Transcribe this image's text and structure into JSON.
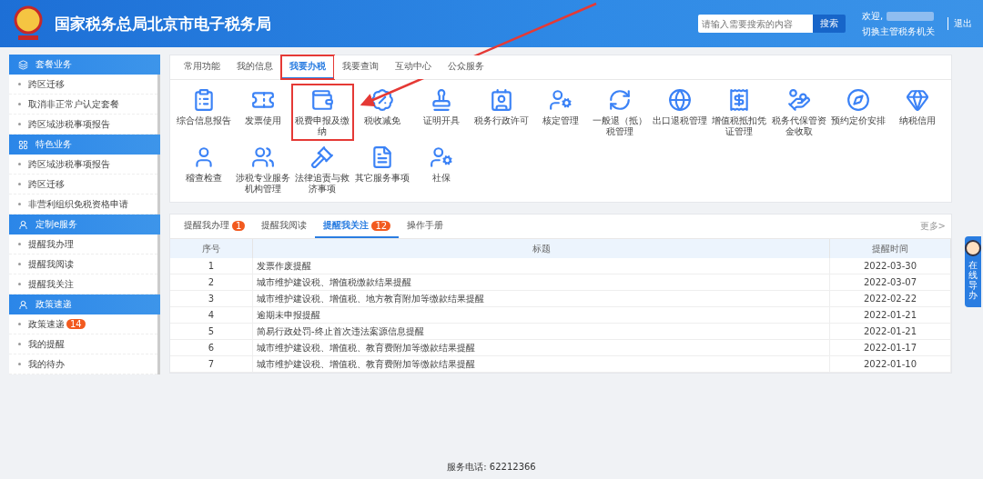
{
  "header": {
    "title": "国家税务总局北京市电子税务局",
    "search": {
      "placeholder": "请输入需要搜索的内容",
      "button": "搜索"
    },
    "welcome": "欢迎,",
    "switch_link": "切换主管税务机关",
    "logout": "退出"
  },
  "sidebar": [
    {
      "title": "套餐业务",
      "items": [
        {
          "label": "跨区迁移"
        },
        {
          "label": "取消非正常户认定套餐"
        },
        {
          "label": "跨区域涉税事项报告"
        }
      ]
    },
    {
      "title": "特色业务",
      "items": [
        {
          "label": "跨区域涉税事项报告"
        },
        {
          "label": "跨区迁移"
        },
        {
          "label": "非营利组织免税资格申请"
        }
      ]
    },
    {
      "title": "定制e服务",
      "items": [
        {
          "label": "提醒我办理"
        },
        {
          "label": "提醒我阅读"
        },
        {
          "label": "提醒我关注"
        }
      ]
    },
    {
      "title": "政策速递",
      "items": [
        {
          "label": "政策速递",
          "badge": "14"
        },
        {
          "label": "我的提醒"
        },
        {
          "label": "我的待办"
        }
      ]
    }
  ],
  "function_tabs": [
    {
      "label": "常用功能",
      "selected": false,
      "highlighted": false
    },
    {
      "label": "我的信息",
      "selected": false,
      "highlighted": false
    },
    {
      "label": "我要办税",
      "selected": true,
      "highlighted": true
    },
    {
      "label": "我要查询",
      "selected": false,
      "highlighted": false
    },
    {
      "label": "互动中心",
      "selected": false,
      "highlighted": false
    },
    {
      "label": "公众服务",
      "selected": false,
      "highlighted": false
    }
  ],
  "functions": [
    {
      "label": "综合信息报告",
      "highlighted": false
    },
    {
      "label": "发票使用",
      "highlighted": false
    },
    {
      "label": "税费申报及缴纳",
      "highlighted": true
    },
    {
      "label": "税收减免",
      "highlighted": false
    },
    {
      "label": "证明开具",
      "highlighted": false
    },
    {
      "label": "税务行政许可",
      "highlighted": false
    },
    {
      "label": "核定管理",
      "highlighted": false
    },
    {
      "label": "一般退（抵）税管理",
      "highlighted": false
    },
    {
      "label": "出口退税管理",
      "highlighted": false
    },
    {
      "label": "增值税抵扣凭证管理",
      "highlighted": false
    },
    {
      "label": "税务代保管资金收取",
      "highlighted": false
    },
    {
      "label": "预约定价安排",
      "highlighted": false
    },
    {
      "label": "纳税信用",
      "highlighted": false
    },
    {
      "label": "稽查检查",
      "highlighted": false
    },
    {
      "label": "涉税专业服务机构管理",
      "highlighted": false
    },
    {
      "label": "法律追责与救济事项",
      "highlighted": false
    },
    {
      "label": "其它服务事项",
      "highlighted": false
    },
    {
      "label": "社保",
      "highlighted": false
    }
  ],
  "reminder_tabs": [
    {
      "label": "提醒我办理",
      "badge": "1",
      "selected": false
    },
    {
      "label": "提醒我阅读",
      "selected": false
    },
    {
      "label": "提醒我关注",
      "badge": "12",
      "selected": true
    },
    {
      "label": "操作手册",
      "selected": false
    }
  ],
  "more_link": "更多>",
  "table": {
    "columns": [
      "序号",
      "标题",
      "提醒时间"
    ],
    "rows": [
      [
        "1",
        "发票作废提醒",
        "2022-03-30"
      ],
      [
        "2",
        "城市维护建设税、增值税缴款结果提醒",
        "2022-03-07"
      ],
      [
        "3",
        "城市维护建设税、增值税、地方教育附加等缴款结果提醒",
        "2022-02-22"
      ],
      [
        "4",
        "逾期未申报提醒",
        "2022-01-21"
      ],
      [
        "5",
        "简易行政处罚-终止首次违法案源信息提醒",
        "2022-01-21"
      ],
      [
        "6",
        "城市维护建设税、增值税、教育费附加等缴款结果提醒",
        "2022-01-17"
      ],
      [
        "7",
        "城市维护建设税、增值税、教育费附加等缴款结果提醒",
        "2022-01-10"
      ]
    ]
  },
  "online_guide": "在线导办",
  "footer": "服务电话: 62212366"
}
